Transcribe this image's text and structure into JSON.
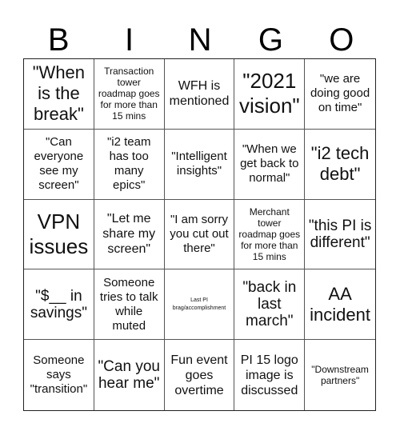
{
  "header": {
    "letters": [
      "B",
      "I",
      "N",
      "G",
      "O"
    ]
  },
  "cells": [
    {
      "text": "\"When is the break\"",
      "size": "s-xl"
    },
    {
      "text": "Transaction tower roadmap goes for more than 15 mins",
      "size": "s-xs"
    },
    {
      "text": "WFH is mentioned",
      "size": "s-m"
    },
    {
      "text": "\"2021 vision\"",
      "size": "s-xxl"
    },
    {
      "text": "\"we are doing good on time\"",
      "size": "s-s"
    },
    {
      "text": "\"Can everyone see my screen\"",
      "size": "s-s"
    },
    {
      "text": "\"i2 team has too many epics\"",
      "size": "s-s"
    },
    {
      "text": "\"Intelligent insights\"",
      "size": "s-s"
    },
    {
      "text": "\"When we get back to normal\"",
      "size": "s-s"
    },
    {
      "text": "\"i2 tech debt\"",
      "size": "s-xl"
    },
    {
      "text": "VPN issues",
      "size": "s-xxl"
    },
    {
      "text": "\"Let me share my screen\"",
      "size": "s-m"
    },
    {
      "text": "\"I am sorry you cut out there\"",
      "size": "s-s"
    },
    {
      "text": "Merchant tower roadmap goes for more than 15 mins",
      "size": "s-xs"
    },
    {
      "text": "\"this PI is different\"",
      "size": "s-l"
    },
    {
      "text": "\"$__ in savings\"",
      "size": "s-l"
    },
    {
      "text": "Someone tries to talk while muted",
      "size": "s-s"
    },
    {
      "text": "Last PI brag/accomplishment",
      "size": "s-xxs"
    },
    {
      "text": "\"back in last march\"",
      "size": "s-l"
    },
    {
      "text": "AA incident",
      "size": "s-xl"
    },
    {
      "text": "Someone says \"transition\"",
      "size": "s-s"
    },
    {
      "text": "\"Can you hear me\"",
      "size": "s-l"
    },
    {
      "text": "Fun event goes overtime",
      "size": "s-m"
    },
    {
      "text": "PI 15 logo image is discussed",
      "size": "s-m"
    },
    {
      "text": "\"Downstream partners\"",
      "size": "s-xs"
    }
  ]
}
